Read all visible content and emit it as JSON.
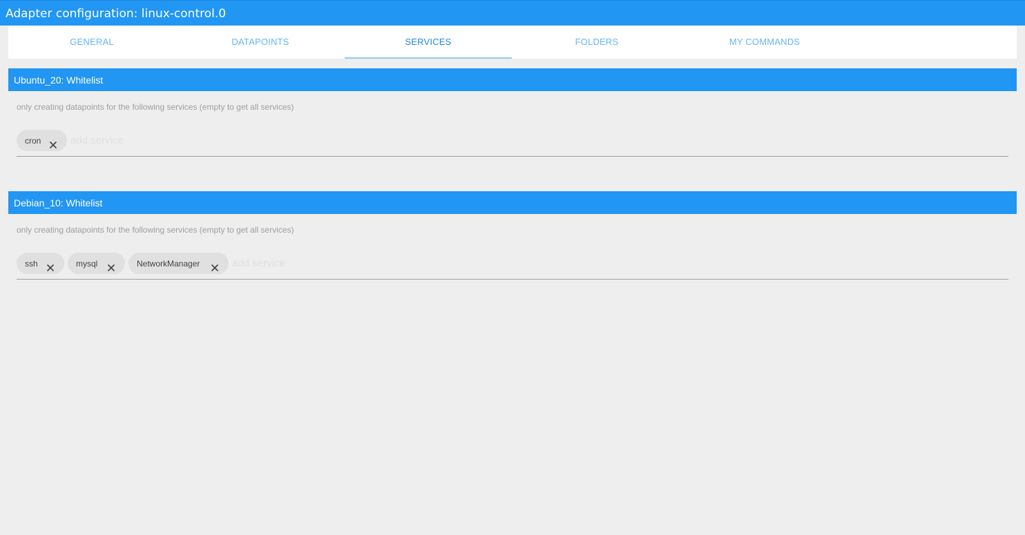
{
  "window": {
    "title": "Adapter configuration: linux-control.0"
  },
  "tabs": [
    {
      "label": "GENERAL",
      "active": false
    },
    {
      "label": "DATAPOINTS",
      "active": false
    },
    {
      "label": "SERVICES",
      "active": true
    },
    {
      "label": "FOLDERS",
      "active": false
    },
    {
      "label": "MY COMMANDS",
      "active": false
    }
  ],
  "sections": [
    {
      "header": "Ubuntu_20: Whitelist",
      "help_text": "only creating datapoints for the following services (empty to get all services)",
      "chips": [
        "cron"
      ],
      "input_placeholder": "add service"
    },
    {
      "header": "Debian_10: Whitelist",
      "help_text": "only creating datapoints for the following services (empty to get all services)",
      "chips": [
        "ssh",
        "mysql",
        "NetworkManager"
      ],
      "input_placeholder": "add service"
    }
  ],
  "icons": {
    "chip_remove": "close-icon"
  },
  "colors": {
    "primary": "#2196f3",
    "tab_text": "#64b5f6",
    "tab_active_text": "#1e88e5",
    "tab_indicator": "#90caf9",
    "background": "#eeeeee",
    "chip_background": "#e0e0e0"
  }
}
